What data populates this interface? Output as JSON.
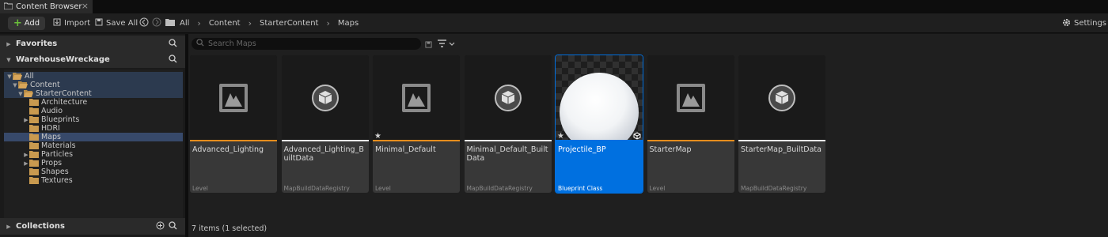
{
  "tab": {
    "title": "Content Browser"
  },
  "toolbar": {
    "add_label": "Add",
    "import_label": "Import",
    "save_all_label": "Save All",
    "settings_label": "Settings"
  },
  "breadcrumb": [
    "All",
    "Content",
    "StarterContent",
    "Maps"
  ],
  "sidebar": {
    "favorites_label": "Favorites",
    "project_label": "WarehouseWreckage",
    "collections_label": "Collections",
    "tree": [
      {
        "label": "All",
        "depth": 0,
        "expanded": true
      },
      {
        "label": "Content",
        "depth": 1,
        "expanded": true
      },
      {
        "label": "StarterContent",
        "depth": 2,
        "expanded": true
      },
      {
        "label": "Architecture",
        "depth": 3,
        "expanded": false
      },
      {
        "label": "Audio",
        "depth": 3,
        "expanded": false
      },
      {
        "label": "Blueprints",
        "depth": 3,
        "expanded": false,
        "has_children": true
      },
      {
        "label": "HDRI",
        "depth": 3,
        "expanded": false
      },
      {
        "label": "Maps",
        "depth": 3,
        "expanded": false,
        "selected": true
      },
      {
        "label": "Materials",
        "depth": 3,
        "expanded": false
      },
      {
        "label": "Particles",
        "depth": 3,
        "expanded": false,
        "has_children": true
      },
      {
        "label": "Props",
        "depth": 3,
        "expanded": false,
        "has_children": true
      },
      {
        "label": "Shapes",
        "depth": 3,
        "expanded": false
      },
      {
        "label": "Textures",
        "depth": 3,
        "expanded": false
      }
    ]
  },
  "search": {
    "placeholder": "Search Maps"
  },
  "assets": [
    {
      "name": "Advanced_Lighting",
      "type": "Level",
      "icon": "map-icon",
      "accent": "#e58c1c"
    },
    {
      "name": "Advanced_Lighting_BuiltData",
      "type": "MapBuildDataRegistry",
      "icon": "data-icon",
      "accent": "#e8e8e8"
    },
    {
      "name": "Minimal_Default",
      "type": "Level",
      "icon": "map-icon",
      "accent": "#e58c1c",
      "starred": true
    },
    {
      "name": "Minimal_Default_BuiltData",
      "type": "MapBuildDataRegistry",
      "icon": "data-icon",
      "accent": "#e8e8e8"
    },
    {
      "name": "Projectile_BP",
      "type": "Blueprint Class",
      "icon": "sphere-thumbnail",
      "accent": "#0070e0",
      "starred": true,
      "selected": true
    },
    {
      "name": "StarterMap",
      "type": "Level",
      "icon": "map-icon",
      "accent": "#e58c1c"
    },
    {
      "name": "StarterMap_BuiltData",
      "type": "MapBuildDataRegistry",
      "icon": "data-icon",
      "accent": "#e8e8e8"
    }
  ],
  "status": {
    "text": "7 items (1 selected)"
  },
  "colors": {
    "accent_blue": "#0070e0",
    "level_orange": "#e58c1c",
    "add_green": "#6abf3a"
  }
}
